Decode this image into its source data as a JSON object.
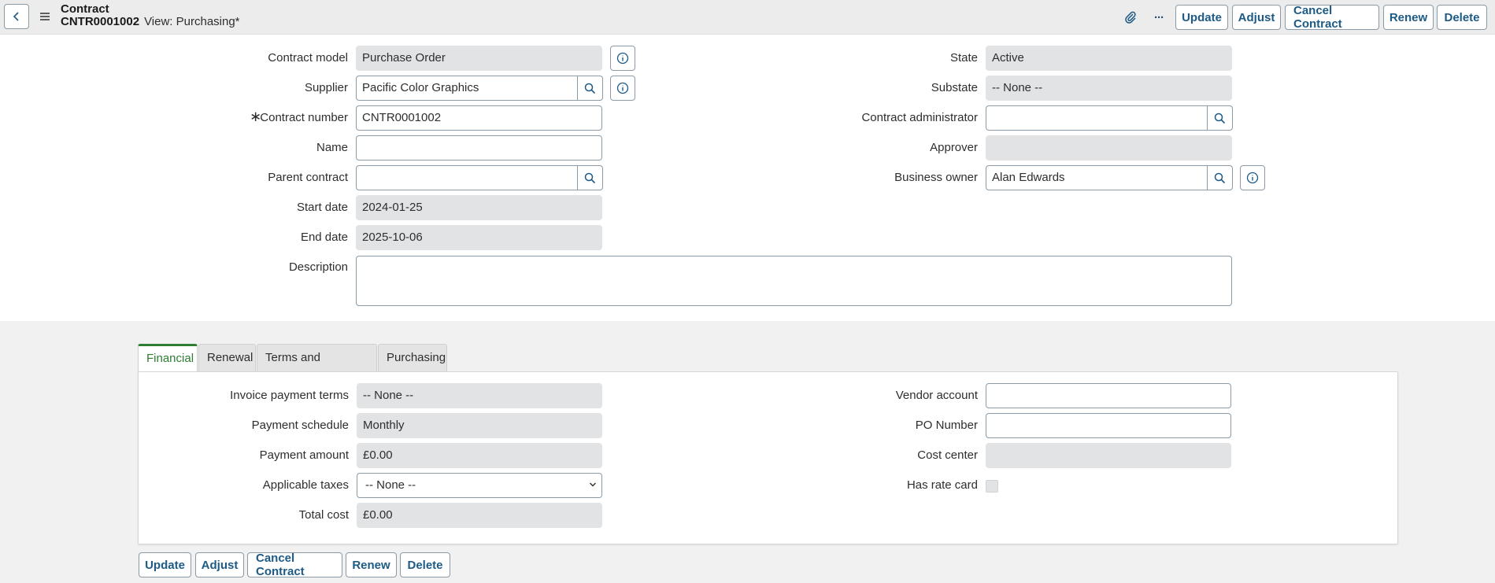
{
  "header": {
    "record_type": "Contract",
    "record_number": "CNTR0001002",
    "view": "View: Purchasing*",
    "buttons": {
      "update": "Update",
      "adjust": "Adjust",
      "cancel_contract": "Cancel Contract",
      "renew": "Renew",
      "delete": "Delete"
    },
    "more": "···"
  },
  "form": {
    "contract_model": {
      "label": "Contract model",
      "value": "Purchase Order"
    },
    "supplier": {
      "label": "Supplier",
      "value": "Pacific Color Graphics"
    },
    "contract_number": {
      "label": "Contract number",
      "value": "CNTR0001002",
      "required_mark": "∗"
    },
    "name": {
      "label": "Name",
      "value": ""
    },
    "parent_contract": {
      "label": "Parent contract",
      "value": ""
    },
    "start_date": {
      "label": "Start date",
      "value": "2024-01-25"
    },
    "end_date": {
      "label": "End date",
      "value": "2025-10-06"
    },
    "description": {
      "label": "Description",
      "value": ""
    },
    "state": {
      "label": "State",
      "value": "Active"
    },
    "substate": {
      "label": "Substate",
      "value": "-- None --"
    },
    "contract_administrator": {
      "label": "Contract administrator",
      "value": ""
    },
    "approver": {
      "label": "Approver",
      "value": ""
    },
    "business_owner": {
      "label": "Business owner",
      "value": "Alan Edwards"
    }
  },
  "tabs": [
    {
      "label": "Financial",
      "active": true
    },
    {
      "label": "Renewal",
      "active": false
    },
    {
      "label": "Terms and Conditions",
      "active": false
    },
    {
      "label": "Purchasing",
      "active": false
    }
  ],
  "financial": {
    "invoice_payment_terms": {
      "label": "Invoice payment terms",
      "value": "-- None --"
    },
    "payment_schedule": {
      "label": "Payment schedule",
      "value": "Monthly"
    },
    "payment_amount": {
      "label": "Payment amount",
      "value": "£0.00"
    },
    "applicable_taxes": {
      "label": "Applicable taxes",
      "value": "-- None --"
    },
    "total_cost": {
      "label": "Total cost",
      "value": "£0.00"
    },
    "vendor_account": {
      "label": "Vendor account",
      "value": ""
    },
    "po_number": {
      "label": "PO Number",
      "value": ""
    },
    "cost_center": {
      "label": "Cost center",
      "value": ""
    },
    "has_rate_card": {
      "label": "Has rate card",
      "checked": false
    }
  },
  "footer": {
    "buttons": {
      "update": "Update",
      "adjust": "Adjust",
      "cancel_contract": "Cancel Contract",
      "renew": "Renew",
      "delete": "Delete"
    }
  },
  "colors": {
    "accent": "#1d5a85",
    "active_tab": "#2e7d32",
    "readonly_bg": "#e1e3e5"
  }
}
